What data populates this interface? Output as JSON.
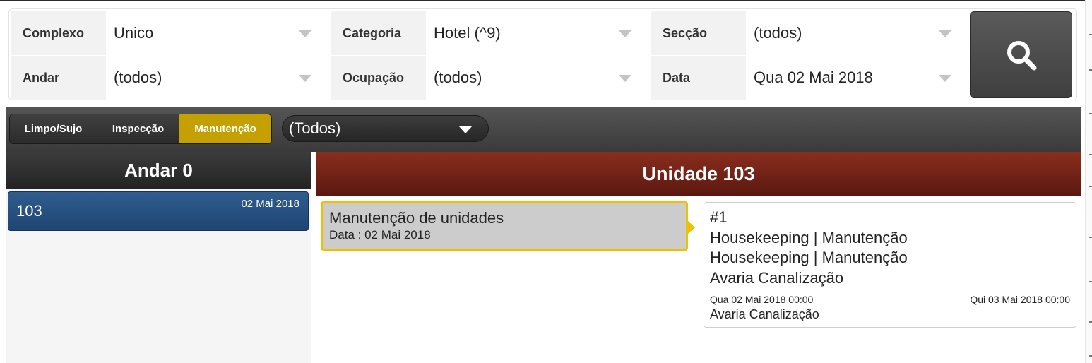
{
  "filters": {
    "complexo": {
      "label": "Complexo",
      "value": "Unico"
    },
    "categoria": {
      "label": "Categoria",
      "value": "Hotel (^9)"
    },
    "seccao": {
      "label": "Secção",
      "value": "(todos)"
    },
    "andar": {
      "label": "Andar",
      "value": "(todos)"
    },
    "ocupacao": {
      "label": "Ocupação",
      "value": "(todos)"
    },
    "data": {
      "label": "Data",
      "value": "Qua 02 Mai 2018"
    },
    "search_icon": "search-icon"
  },
  "toolbar": {
    "tabs": [
      {
        "label": "Limpo/Sujo",
        "active": false
      },
      {
        "label": "Inspecção",
        "active": false
      },
      {
        "label": "Manutenção",
        "active": true
      }
    ],
    "filter_select": "(Todos)",
    "active_color": "#c4a000"
  },
  "floor": {
    "header": "Andar 0",
    "units": [
      {
        "name": "103",
        "date": "02 Mai 2018"
      }
    ]
  },
  "unit": {
    "header": "Unidade 103",
    "header_color": "#7a2618",
    "task": {
      "title": "Manutenção de unidades",
      "date": "Data : 02 Mai 2018",
      "border_color": "#f0c000"
    },
    "detail": {
      "number": "#1",
      "line1": "Housekeeping | Manutenção",
      "line2": "Housekeeping | Manutenção",
      "line3": "Avaria Canalização",
      "start": "Qua 02 Mai 2018 00:00",
      "end": "Qui 03 Mai 2018 00:00",
      "note": "Avaria Canalização"
    }
  }
}
